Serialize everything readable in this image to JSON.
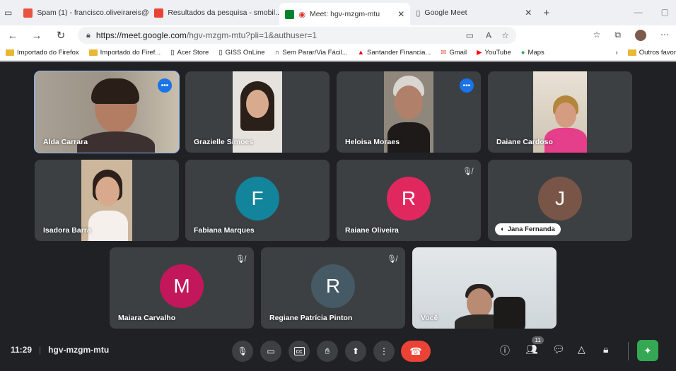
{
  "browser": {
    "tabs": [
      {
        "label": "Spam (1) - francisco.oliveirareis@...",
        "favicon_color": "#e8543e"
      },
      {
        "label": "Resultados da pesquisa - smobil...",
        "favicon_color": "#ea4335"
      },
      {
        "label": "Meet: hgv-mzgm-mtu",
        "favicon_color": "#00832d"
      },
      {
        "label": "Google Meet",
        "favicon_color": "#888888"
      }
    ],
    "url_host": "https://meet.google.com",
    "url_path": "/hgv-mzgm-mtu?pli=1&authuser=1",
    "bookmarks": [
      "Importado do Firefox",
      "Importado do Firef...",
      "Acer Store",
      "GISS OnLine",
      "Sem Parar/Via Fácil...",
      "Santander Financia...",
      "Gmail",
      "YouTube",
      "Maps",
      "Outros favor"
    ]
  },
  "participants": [
    {
      "name": "Alda Carrara",
      "type": "video",
      "more": true
    },
    {
      "name": "Grazielle Simoes",
      "type": "video"
    },
    {
      "name": "Heloisa Moraes",
      "type": "video",
      "speaking": true
    },
    {
      "name": "Daiane Cardoso",
      "type": "video"
    },
    {
      "name": "Isadora Barra",
      "type": "video"
    },
    {
      "name": "Fabiana Marques",
      "type": "avatar",
      "initial": "F",
      "color": "#12849b"
    },
    {
      "name": "Raiane Oliveira",
      "type": "avatar",
      "initial": "R",
      "color": "#e0285e",
      "muted": true
    },
    {
      "name": "Jana Fernanda",
      "type": "avatar",
      "initial": "J",
      "color": "#795548"
    },
    {
      "name": "Maiara Carvalho",
      "type": "avatar",
      "initial": "M",
      "color": "#c2185b",
      "muted": true
    },
    {
      "name": "Regiane Patrícia Pinton",
      "type": "avatar",
      "initial": "R",
      "color": "#455a64",
      "muted": true
    },
    {
      "name": "Você",
      "type": "video"
    }
  ],
  "meeting": {
    "time": "11:29",
    "code": "hgv-mzgm-mtu",
    "people_count": "11"
  },
  "colors": {
    "meet_bg": "#202124",
    "tile_bg": "#3c4043",
    "end_call": "#ea4335",
    "accent": "#1a73e8"
  }
}
